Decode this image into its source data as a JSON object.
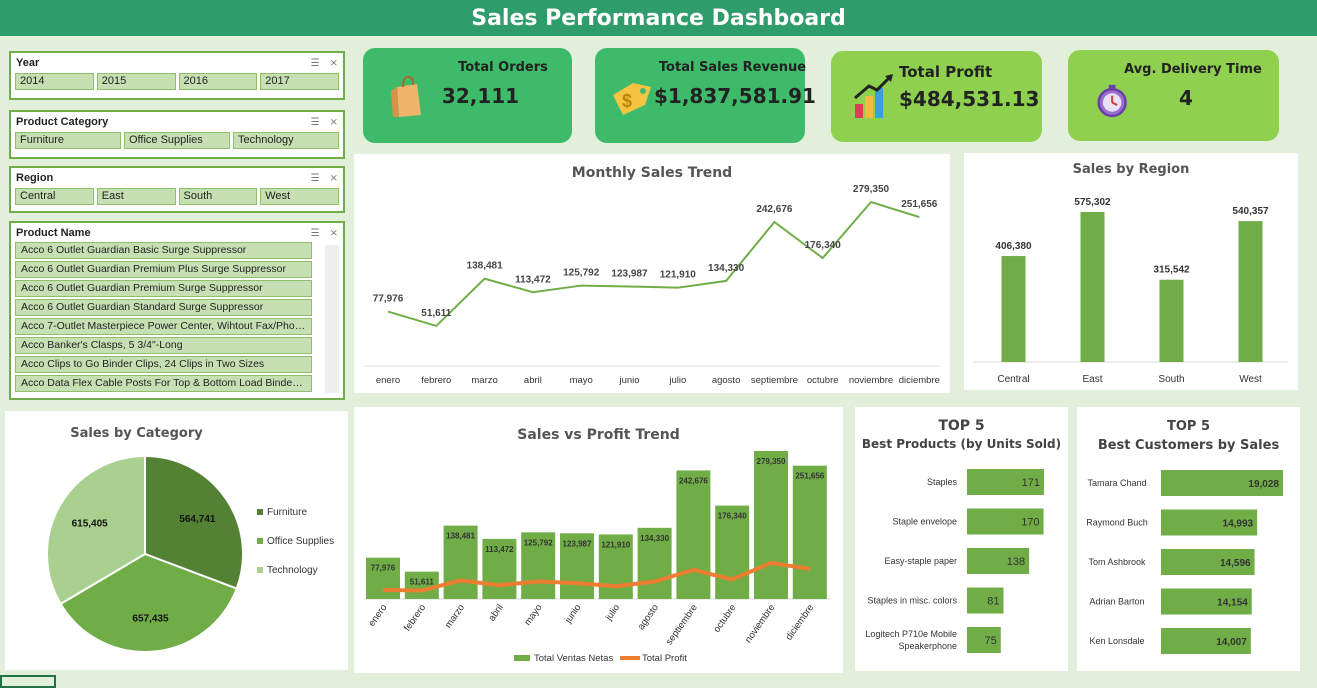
{
  "title": "Sales Performance Dashboard",
  "slicers": {
    "year": {
      "title": "Year",
      "items": [
        "2014",
        "2015",
        "2016",
        "2017"
      ]
    },
    "category": {
      "title": "Product Category",
      "items": [
        "Furniture",
        "Office Supplies",
        "Technology"
      ]
    },
    "region": {
      "title": "Region",
      "items": [
        "Central",
        "East",
        "South",
        "West"
      ]
    },
    "product": {
      "title": "Product Name",
      "items": [
        "Acco 6 Outlet Guardian Basic Surge Suppressor",
        "Acco 6 Outlet Guardian Premium Plus Surge Suppressor",
        "Acco 6 Outlet Guardian Premium Surge Suppressor",
        "Acco 6 Outlet Guardian Standard Surge Suppressor",
        "Acco 7-Outlet Masterpiece Power Center, Wihtout Fax/Phone...",
        "Acco Banker's Clasps, 5 3/4\"-Long",
        "Acco Clips to Go Binder Clips, 24 Clips in Two Sizes",
        "Acco Data Flex Cable Posts For Top & Bottom Load Binders, 6..."
      ]
    }
  },
  "kpis": {
    "orders": {
      "label": "Total Orders",
      "value": "32,111",
      "color": "#3dbb6a"
    },
    "revenue": {
      "label": "Total Sales Revenue",
      "value": "$1,837,581.91",
      "color": "#3dbb6a"
    },
    "profit": {
      "label": "Total Profit",
      "value": "$484,531.13",
      "color": "#8fd14f"
    },
    "delivery": {
      "label": "Avg. Delivery Time",
      "value": "4",
      "color": "#8fd14f"
    }
  },
  "colors": {
    "bar": "#70ad47",
    "profit_line": "#ed7d31",
    "pie": [
      "#548235",
      "#70ad47",
      "#a9d08e"
    ]
  },
  "chart_data": [
    {
      "id": "monthly",
      "type": "line",
      "title": "Monthly Sales Trend",
      "categories": [
        "enero",
        "febrero",
        "marzo",
        "abril",
        "mayo",
        "junio",
        "julio",
        "agosto",
        "septiembre",
        "octubre",
        "noviembre",
        "diciembre"
      ],
      "values": [
        77976,
        51611,
        138481,
        113472,
        125792,
        123987,
        121910,
        134330,
        242676,
        176340,
        279350,
        251656
      ],
      "labels": [
        "77,976",
        "51,611",
        "138,481",
        "113,472",
        "125,792",
        "123,987",
        "121,910",
        "134,330",
        "242,676",
        "176,340",
        "279,350",
        "251,656"
      ]
    },
    {
      "id": "region",
      "type": "bar",
      "title": "Sales by Region",
      "categories": [
        "Central",
        "East",
        "South",
        "West"
      ],
      "values": [
        406380,
        575302,
        315542,
        540357
      ],
      "labels": [
        "406,380",
        "575,302",
        "315,542",
        "540,357"
      ]
    },
    {
      "id": "category",
      "type": "pie",
      "title": "Sales by Category",
      "categories": [
        "Furniture",
        "Office Supplies",
        "Technology"
      ],
      "values": [
        564741,
        657435,
        615405
      ],
      "labels": [
        "564,741",
        "657,435",
        "615,405"
      ],
      "legend": "right"
    },
    {
      "id": "salesprofit",
      "type": "bar",
      "title": "Sales vs Profit Trend",
      "categories": [
        "enero",
        "febrero",
        "marzo",
        "abril",
        "mayo",
        "junio",
        "julio",
        "agosto",
        "septiembre",
        "octubre",
        "noviembre",
        "diciembre"
      ],
      "series": [
        {
          "name": "Total Ventas Netas",
          "type": "bar",
          "values": [
            77976,
            51611,
            138481,
            113472,
            125792,
            123987,
            121910,
            134330,
            242676,
            176340,
            279350,
            251656
          ],
          "labels": [
            "77,976",
            "51,611",
            "138,481",
            "113,472",
            "125,792",
            "123,987",
            "121,910",
            "134,330",
            "242,676",
            "176,340",
            "279,350",
            "251,656"
          ]
        },
        {
          "name": "Total Profit",
          "type": "line",
          "values": [
            17000,
            16000,
            35000,
            26000,
            33000,
            30000,
            24000,
            33000,
            55000,
            37000,
            68000,
            57000
          ]
        }
      ],
      "legend": "bottom"
    },
    {
      "id": "topproducts",
      "type": "bar",
      "title": "TOP 5",
      "subtitle": "Best Products (by Units Sold)",
      "categories": [
        "Staples",
        "Staple envelope",
        "Easy-staple paper",
        "Staples in misc. colors",
        "Logitech P710e Mobile Speakerphone"
      ],
      "values": [
        171,
        170,
        138,
        81,
        75
      ],
      "labels": [
        "171",
        "170",
        "138",
        "81",
        "75"
      ]
    },
    {
      "id": "topcustomers",
      "type": "bar",
      "title": "TOP 5",
      "subtitle": "Best Customers by Sales",
      "categories": [
        "Tamara Chand",
        "Raymond Buch",
        "Tom Ashbrook",
        "Adrian Barton",
        "Ken Lonsdale"
      ],
      "values": [
        19028,
        14993,
        14596,
        14154,
        14007
      ],
      "labels": [
        "19,028",
        "14,993",
        "14,596",
        "14,154",
        "14,007"
      ]
    }
  ]
}
